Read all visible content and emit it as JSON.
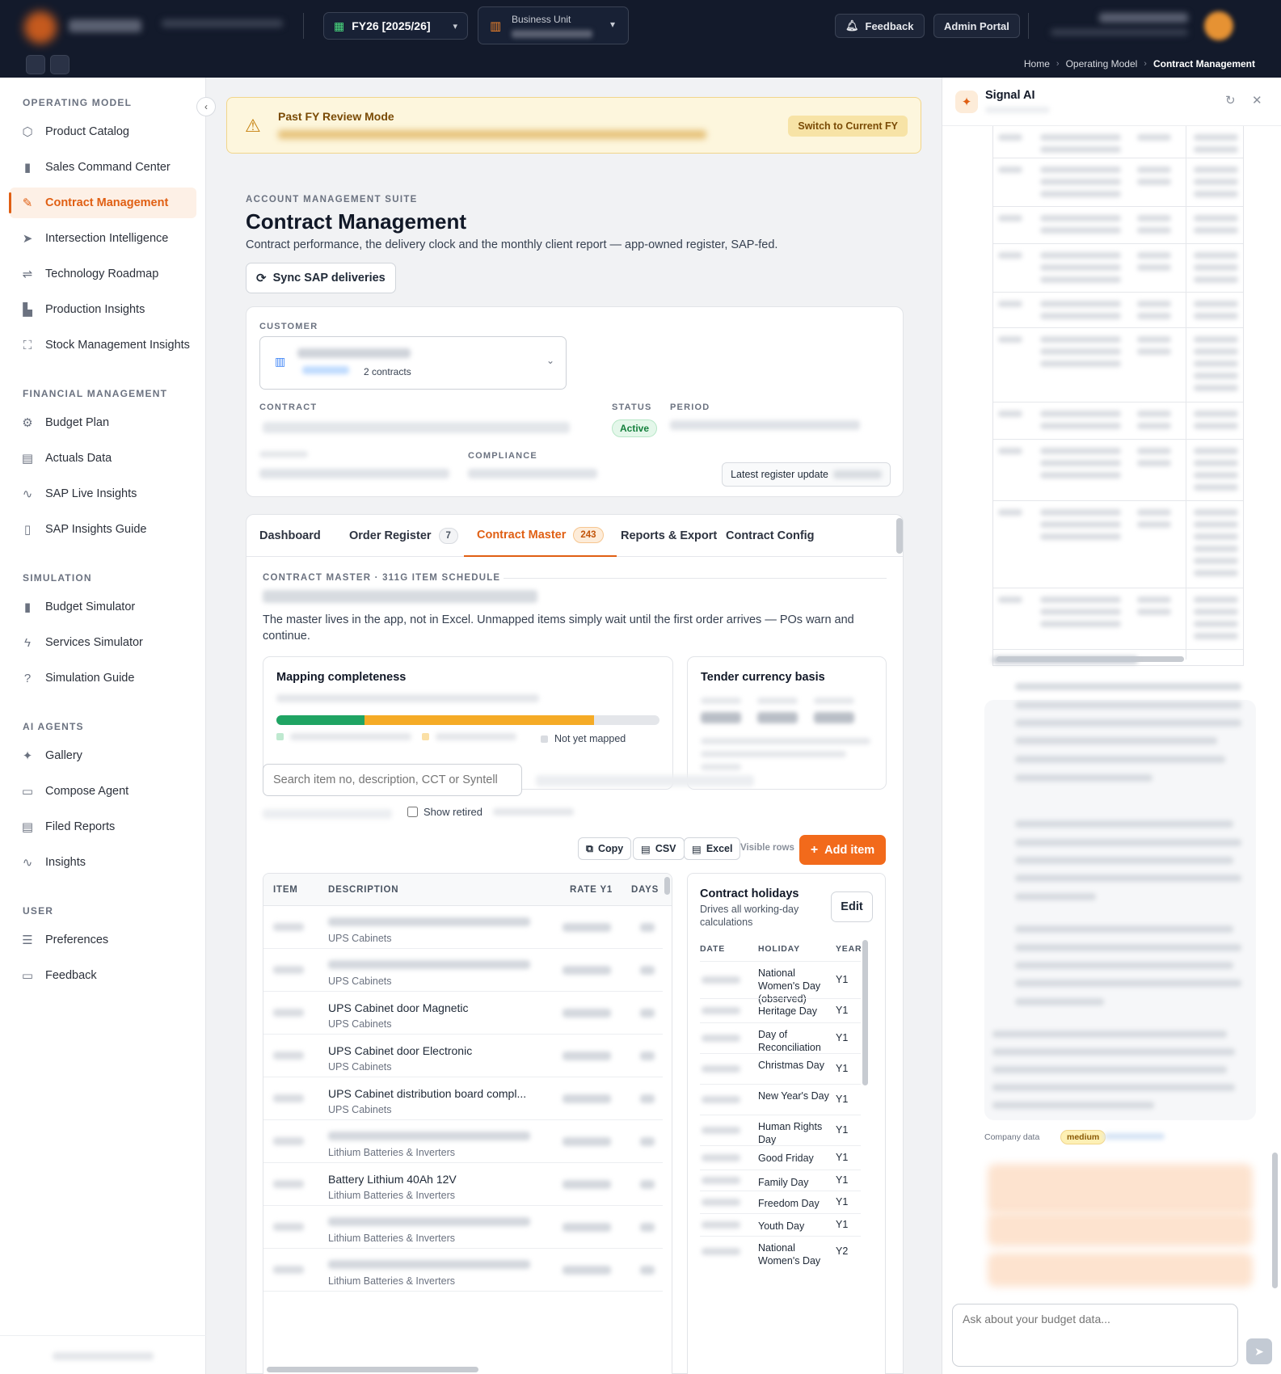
{
  "topbar": {
    "fy_label": "FY26 [2025/26]",
    "bu_label": "Business Unit",
    "feedback_label": "Feedback",
    "admin_label": "Admin Portal"
  },
  "breadcrumb": [
    "Home",
    "Operating Model",
    "Contract Management"
  ],
  "sidebar": {
    "sections": [
      {
        "title": "OPERATING MODEL",
        "items": [
          {
            "label": "Product Catalog",
            "icon": "cube-icon"
          },
          {
            "label": "Sales Command Center",
            "icon": "bar-chart-icon"
          },
          {
            "label": "Contract Management",
            "icon": "edit-icon",
            "active": true
          },
          {
            "label": "Intersection Intelligence",
            "icon": "navigation-icon"
          },
          {
            "label": "Technology Roadmap",
            "icon": "route-icon"
          },
          {
            "label": "Production Insights",
            "icon": "factory-icon"
          },
          {
            "label": "Stock Management Insights",
            "icon": "boxes-icon"
          }
        ]
      },
      {
        "title": "FINANCIAL MANAGEMENT",
        "items": [
          {
            "label": "Budget Plan",
            "icon": "gear-icon"
          },
          {
            "label": "Actuals Data",
            "icon": "document-icon"
          },
          {
            "label": "SAP Live Insights",
            "icon": "activity-icon"
          },
          {
            "label": "SAP Insights Guide",
            "icon": "book-icon"
          }
        ]
      },
      {
        "title": "SIMULATION",
        "items": [
          {
            "label": "Budget Simulator",
            "icon": "bar-chart-icon"
          },
          {
            "label": "Services Simulator",
            "icon": "lightning-icon"
          },
          {
            "label": "Simulation Guide",
            "icon": "help-icon"
          }
        ]
      },
      {
        "title": "AI AGENTS",
        "items": [
          {
            "label": "Gallery",
            "icon": "sparkles-icon"
          },
          {
            "label": "Compose Agent",
            "icon": "message-icon"
          },
          {
            "label": "Filed Reports",
            "icon": "document-icon"
          },
          {
            "label": "Insights",
            "icon": "activity-icon"
          }
        ]
      },
      {
        "title": "USER",
        "items": [
          {
            "label": "Preferences",
            "icon": "sliders-icon"
          },
          {
            "label": "Feedback",
            "icon": "message-icon"
          }
        ]
      }
    ]
  },
  "banner": {
    "title": "Past FY Review Mode",
    "button": "Switch to Current FY"
  },
  "page": {
    "suite": "ACCOUNT MANAGEMENT SUITE",
    "title": "Contract Management",
    "description": "Contract performance, the delivery clock and the monthly client report — app-owned register, SAP-fed.",
    "sync_label": "Sync SAP deliveries"
  },
  "contract_card": {
    "customer_label": "CUSTOMER",
    "contracts_count": "2 contracts",
    "contract_label": "CONTRACT",
    "status_label": "STATUS",
    "status_value": "Active",
    "period_label": "PERIOD",
    "compliance_label": "COMPLIANCE",
    "update_label": "Latest register update"
  },
  "tabs": [
    {
      "label": "Dashboard"
    },
    {
      "label": "Order Register",
      "count": "7"
    },
    {
      "label": "Contract Master",
      "count": "243",
      "active": true
    },
    {
      "label": "Reports & Export"
    },
    {
      "label": "Contract Config"
    }
  ],
  "master": {
    "section_title": "CONTRACT MASTER · 311G ITEM SCHEDULE",
    "description": "The master lives in the app, not in Excel. Unmapped items simply wait until the first order arrives — POs warn and continue.",
    "mapping_title": "Mapping completeness",
    "mapping_progress": {
      "green": 0.23,
      "orange": 0.6,
      "grey": 0.17
    },
    "not_mapped_label": "Not yet mapped",
    "currency_title": "Tender currency basis",
    "search_placeholder": "Search item no, description, CCT or Syntell",
    "show_retired": "Show retired",
    "copy_label": "Copy",
    "csv_label": "CSV",
    "excel_label": "Excel",
    "visible_rows": "Visible rows",
    "add_item": "Add item",
    "colors": {
      "green": "#1fa463",
      "orange": "#f5ab26",
      "grey": "#e4e6ea",
      "accent": "#f26a1b"
    }
  },
  "items_table": {
    "headers": [
      "ITEM",
      "DESCRIPTION",
      "RATE Y1",
      "DAYS"
    ],
    "rows": [
      {
        "desc": "",
        "cat": "UPS Cabinets",
        "blurred": true
      },
      {
        "desc": "",
        "cat": "UPS Cabinets",
        "blurred": true
      },
      {
        "desc": "UPS Cabinet door Magnetic",
        "cat": "UPS Cabinets"
      },
      {
        "desc": "UPS Cabinet door Electronic",
        "cat": "UPS Cabinets"
      },
      {
        "desc": "UPS Cabinet distribution board compl...",
        "cat": "UPS Cabinets"
      },
      {
        "desc": "",
        "cat": "Lithium Batteries & Inverters",
        "blurred": true
      },
      {
        "desc": "Battery Lithium 40Ah 12V",
        "cat": "Lithium Batteries & Inverters"
      },
      {
        "desc": "",
        "cat": "Lithium Batteries & Inverters",
        "blurred": true
      },
      {
        "desc": "",
        "cat": "Lithium Batteries & Inverters",
        "blurred": true
      }
    ]
  },
  "holidays": {
    "title": "Contract holidays",
    "subtitle": "Drives all working-day calculations",
    "edit_label": "Edit",
    "headers": [
      "DATE",
      "HOLIDAY",
      "YEAR"
    ],
    "rows": [
      {
        "name": "National Women's Day (observed)",
        "year": "Y1"
      },
      {
        "name": "Heritage Day",
        "year": "Y1"
      },
      {
        "name": "Day of Reconciliation",
        "year": "Y1"
      },
      {
        "name": "Christmas Day",
        "year": "Y1"
      },
      {
        "name": "New Year's Day",
        "year": "Y1"
      },
      {
        "name": "Human Rights Day",
        "year": "Y1"
      },
      {
        "name": "Good Friday",
        "year": "Y1"
      },
      {
        "name": "Family Day",
        "year": "Y1"
      },
      {
        "name": "Freedom Day",
        "year": "Y1"
      },
      {
        "name": "Youth Day",
        "year": "Y1"
      },
      {
        "name": "National Women's Day",
        "year": "Y2"
      }
    ]
  },
  "ai_panel": {
    "title": "Signal AI",
    "company_data": "Company data",
    "confidence": "medium",
    "input_placeholder": "Ask about your budget data..."
  }
}
